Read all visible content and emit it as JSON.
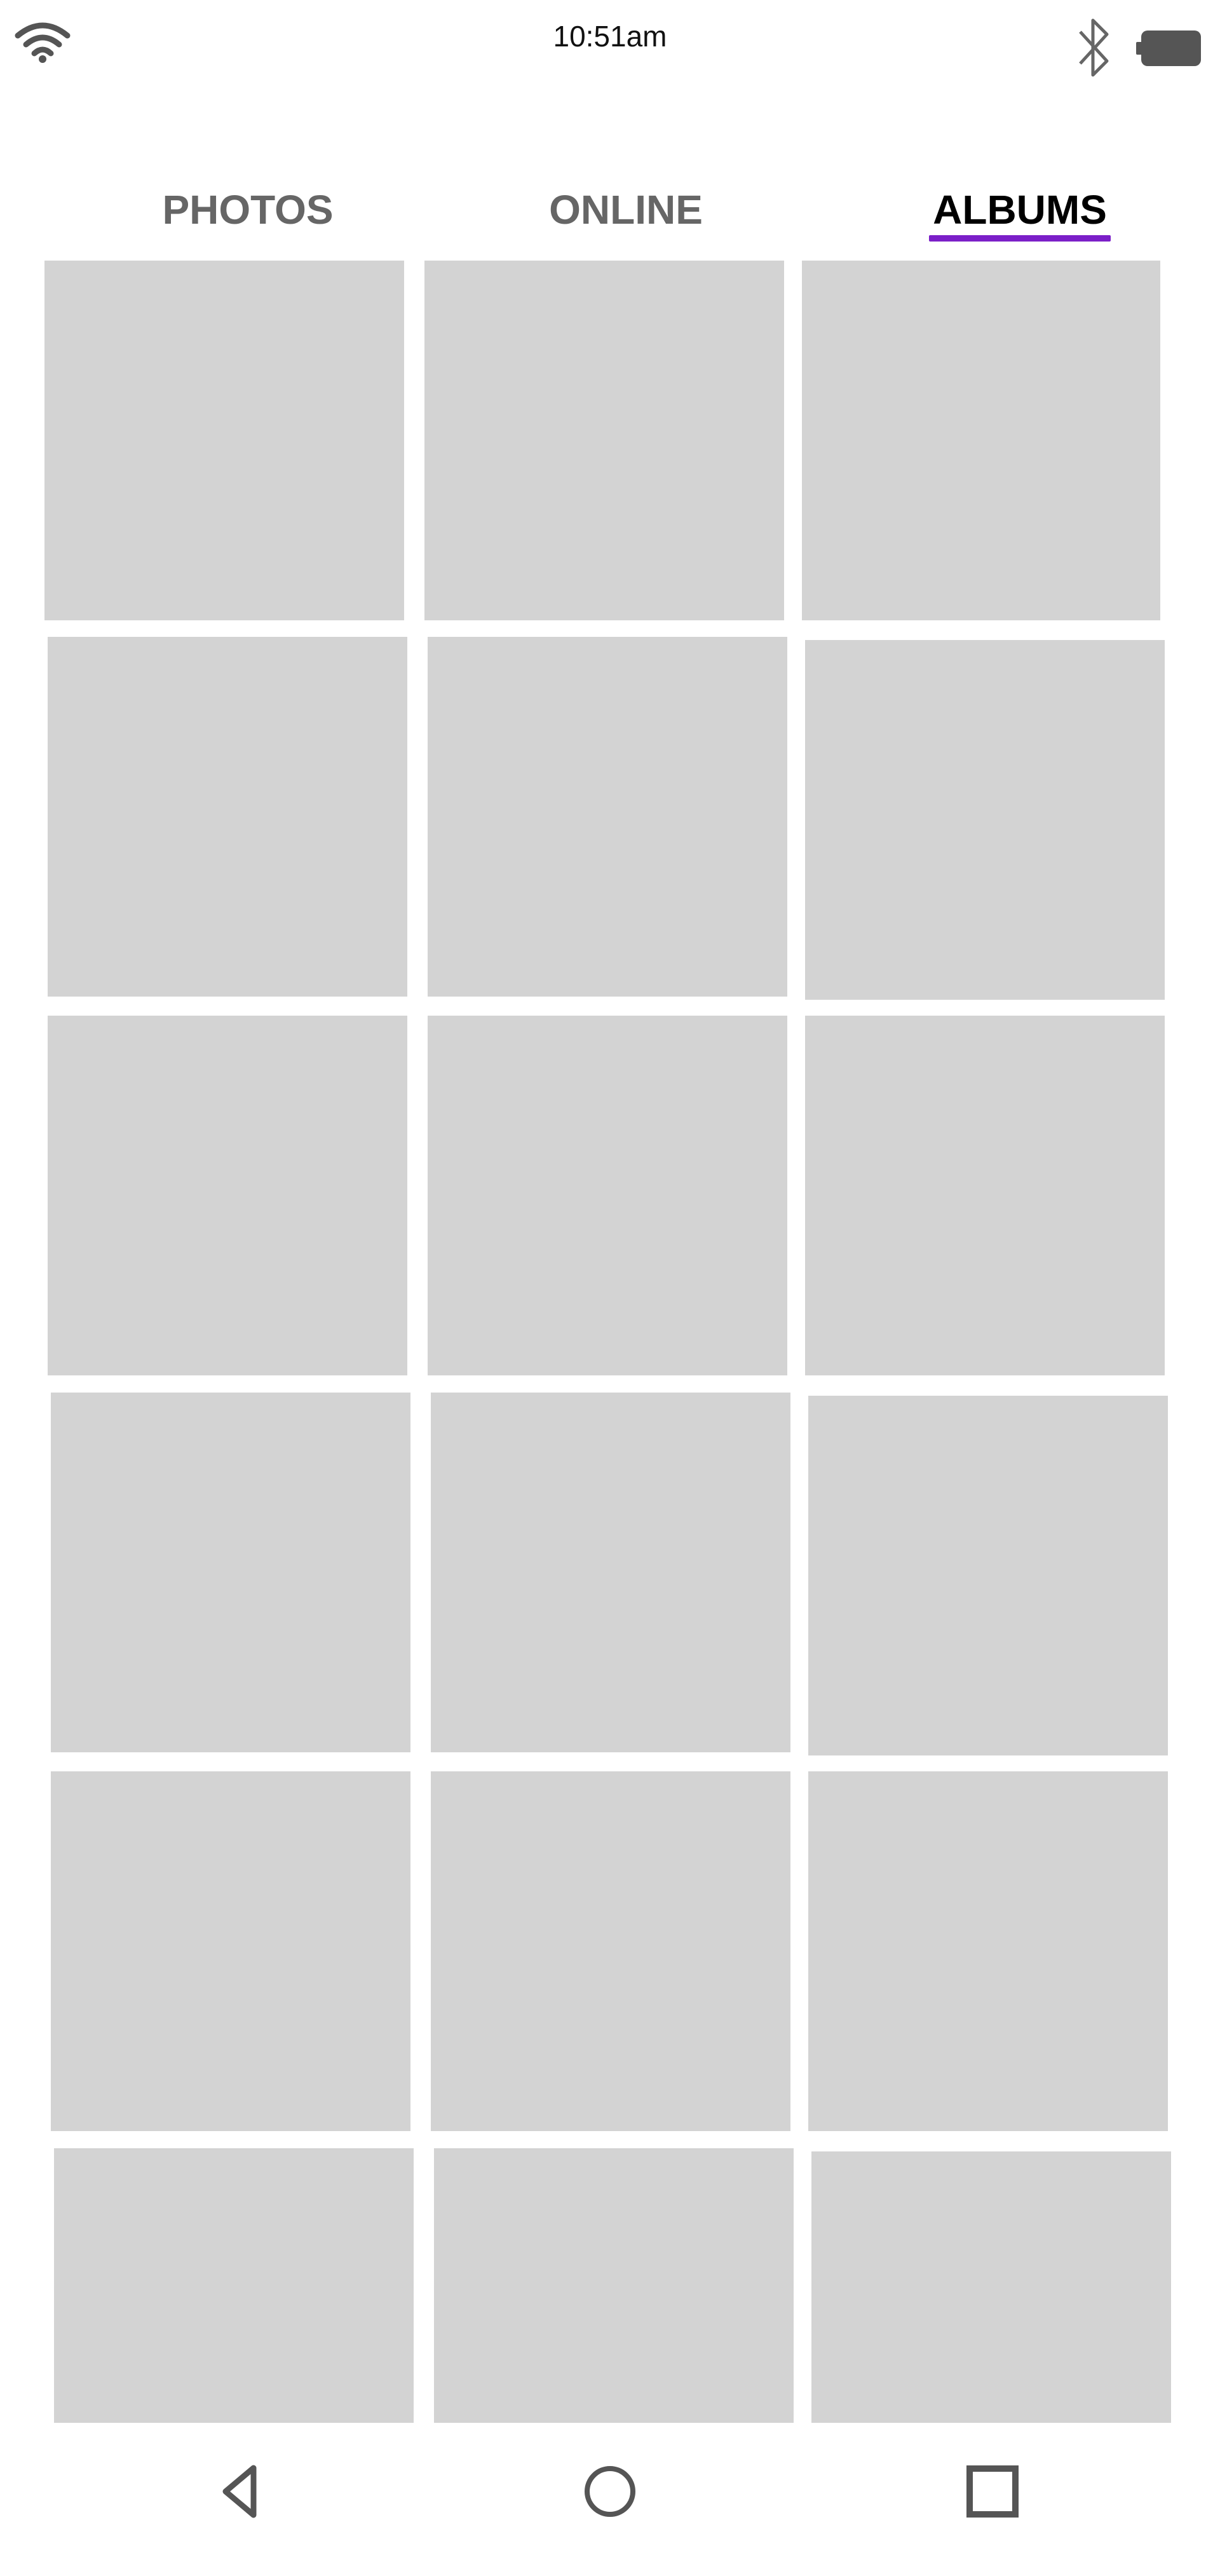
{
  "status_bar": {
    "time": "10:51am",
    "icons": [
      "wifi-icon",
      "bluetooth-icon",
      "battery-icon"
    ]
  },
  "tabs": [
    {
      "label": "PHOTOS",
      "selected": false
    },
    {
      "label": "ONLINE",
      "selected": false
    },
    {
      "label": "ALBUMS",
      "selected": true
    }
  ],
  "colors": {
    "accent": "#7b1fc8",
    "placeholder": "#d3d3d3",
    "tab_inactive": "#666666",
    "tab_active": "#000000"
  },
  "grid": {
    "columns": 3,
    "rows": 6,
    "item_count": 18
  },
  "nav_bar": {
    "icons": [
      "back-icon",
      "home-icon",
      "recents-icon"
    ]
  }
}
